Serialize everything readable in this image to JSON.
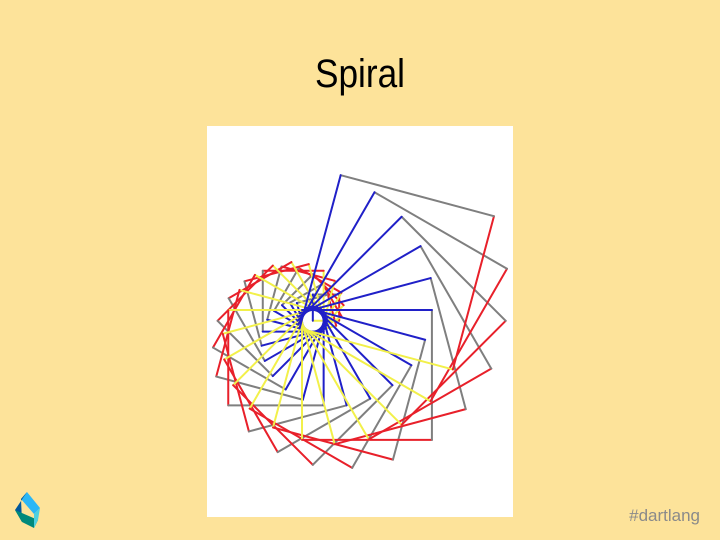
{
  "slide": {
    "title": "Spiral",
    "hashtag": "#dartlang"
  },
  "logo": {
    "icon": "dart-logo-icon",
    "colors": [
      "#2bb7f6",
      "#01579b",
      "#00897b",
      "#4dd0e1"
    ]
  },
  "drawing": {
    "background": "#ffffff",
    "square_count": 24,
    "turn_degrees": 15,
    "side_colors": [
      "#e8202a",
      "#7f7f7f",
      "#2020c8",
      "#f2f04a"
    ]
  }
}
